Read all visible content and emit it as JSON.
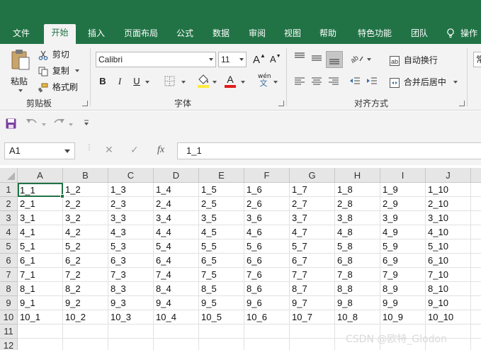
{
  "tabs": [
    {
      "label": "文件",
      "active": false
    },
    {
      "label": "开始",
      "active": true
    },
    {
      "label": "插入",
      "active": false
    },
    {
      "label": "页面布局",
      "active": false
    },
    {
      "label": "公式",
      "active": false
    },
    {
      "label": "数据",
      "active": false
    },
    {
      "label": "审阅",
      "active": false
    },
    {
      "label": "视图",
      "active": false
    },
    {
      "label": "帮助",
      "active": false
    },
    {
      "label": "特色功能",
      "active": false
    },
    {
      "label": "团队",
      "active": false
    }
  ],
  "tell_me": "操作",
  "clipboard": {
    "paste": "粘贴",
    "cut": "剪切",
    "copy": "复制",
    "format_painter": "格式刷",
    "group_label": "剪贴板"
  },
  "font": {
    "font_name": "Calibri",
    "font_size": "11",
    "bold": "B",
    "italic": "I",
    "underline": "U",
    "grow": "A",
    "shrink": "A",
    "font_color_letter": "A",
    "phonetic": "wén",
    "group_label": "字体",
    "fill_color": "#ffeb3b",
    "font_color": "#e21c1c"
  },
  "alignment": {
    "wrap_text": "自动换行",
    "merge_center": "合并后居中",
    "group_label": "对齐方式"
  },
  "number": {
    "format": "常"
  },
  "name_box": "A1",
  "formula_value": "1_1",
  "fx_label": "fx",
  "columns": [
    "A",
    "B",
    "C",
    "D",
    "E",
    "F",
    "G",
    "H",
    "I",
    "J"
  ],
  "rows": [
    {
      "num": "1",
      "cells": [
        "1_1",
        "1_2",
        "1_3",
        "1_4",
        "1_5",
        "1_6",
        "1_7",
        "1_8",
        "1_9",
        "1_10"
      ]
    },
    {
      "num": "2",
      "cells": [
        "2_1",
        "2_2",
        "2_3",
        "2_4",
        "2_5",
        "2_6",
        "2_7",
        "2_8",
        "2_9",
        "2_10"
      ]
    },
    {
      "num": "3",
      "cells": [
        "3_1",
        "3_2",
        "3_3",
        "3_4",
        "3_5",
        "3_6",
        "3_7",
        "3_8",
        "3_9",
        "3_10"
      ]
    },
    {
      "num": "4",
      "cells": [
        "4_1",
        "4_2",
        "4_3",
        "4_4",
        "4_5",
        "4_6",
        "4_7",
        "4_8",
        "4_9",
        "4_10"
      ]
    },
    {
      "num": "5",
      "cells": [
        "5_1",
        "5_2",
        "5_3",
        "5_4",
        "5_5",
        "5_6",
        "5_7",
        "5_8",
        "5_9",
        "5_10"
      ]
    },
    {
      "num": "6",
      "cells": [
        "6_1",
        "6_2",
        "6_3",
        "6_4",
        "6_5",
        "6_6",
        "6_7",
        "6_8",
        "6_9",
        "6_10"
      ]
    },
    {
      "num": "7",
      "cells": [
        "7_1",
        "7_2",
        "7_3",
        "7_4",
        "7_5",
        "7_6",
        "7_7",
        "7_8",
        "7_9",
        "7_10"
      ]
    },
    {
      "num": "8",
      "cells": [
        "8_1",
        "8_2",
        "8_3",
        "8_4",
        "8_5",
        "8_6",
        "8_7",
        "8_8",
        "8_9",
        "8_10"
      ]
    },
    {
      "num": "9",
      "cells": [
        "9_1",
        "9_2",
        "9_3",
        "9_4",
        "9_5",
        "9_6",
        "9_7",
        "9_8",
        "9_9",
        "9_10"
      ]
    },
    {
      "num": "10",
      "cells": [
        "10_1",
        "10_2",
        "10_3",
        "10_4",
        "10_5",
        "10_6",
        "10_7",
        "10_8",
        "10_9",
        "10_10"
      ]
    },
    {
      "num": "11",
      "cells": [
        "",
        "",
        "",
        "",
        "",
        "",
        "",
        "",
        "",
        ""
      ]
    },
    {
      "num": "12",
      "cells": [
        "",
        "",
        "",
        "",
        "",
        "",
        "",
        "",
        "",
        ""
      ]
    }
  ],
  "watermark": "CSDN @欧特_Glodon",
  "colors": {
    "accent": "#217346",
    "ribbon_bg": "#f3f3f3"
  }
}
